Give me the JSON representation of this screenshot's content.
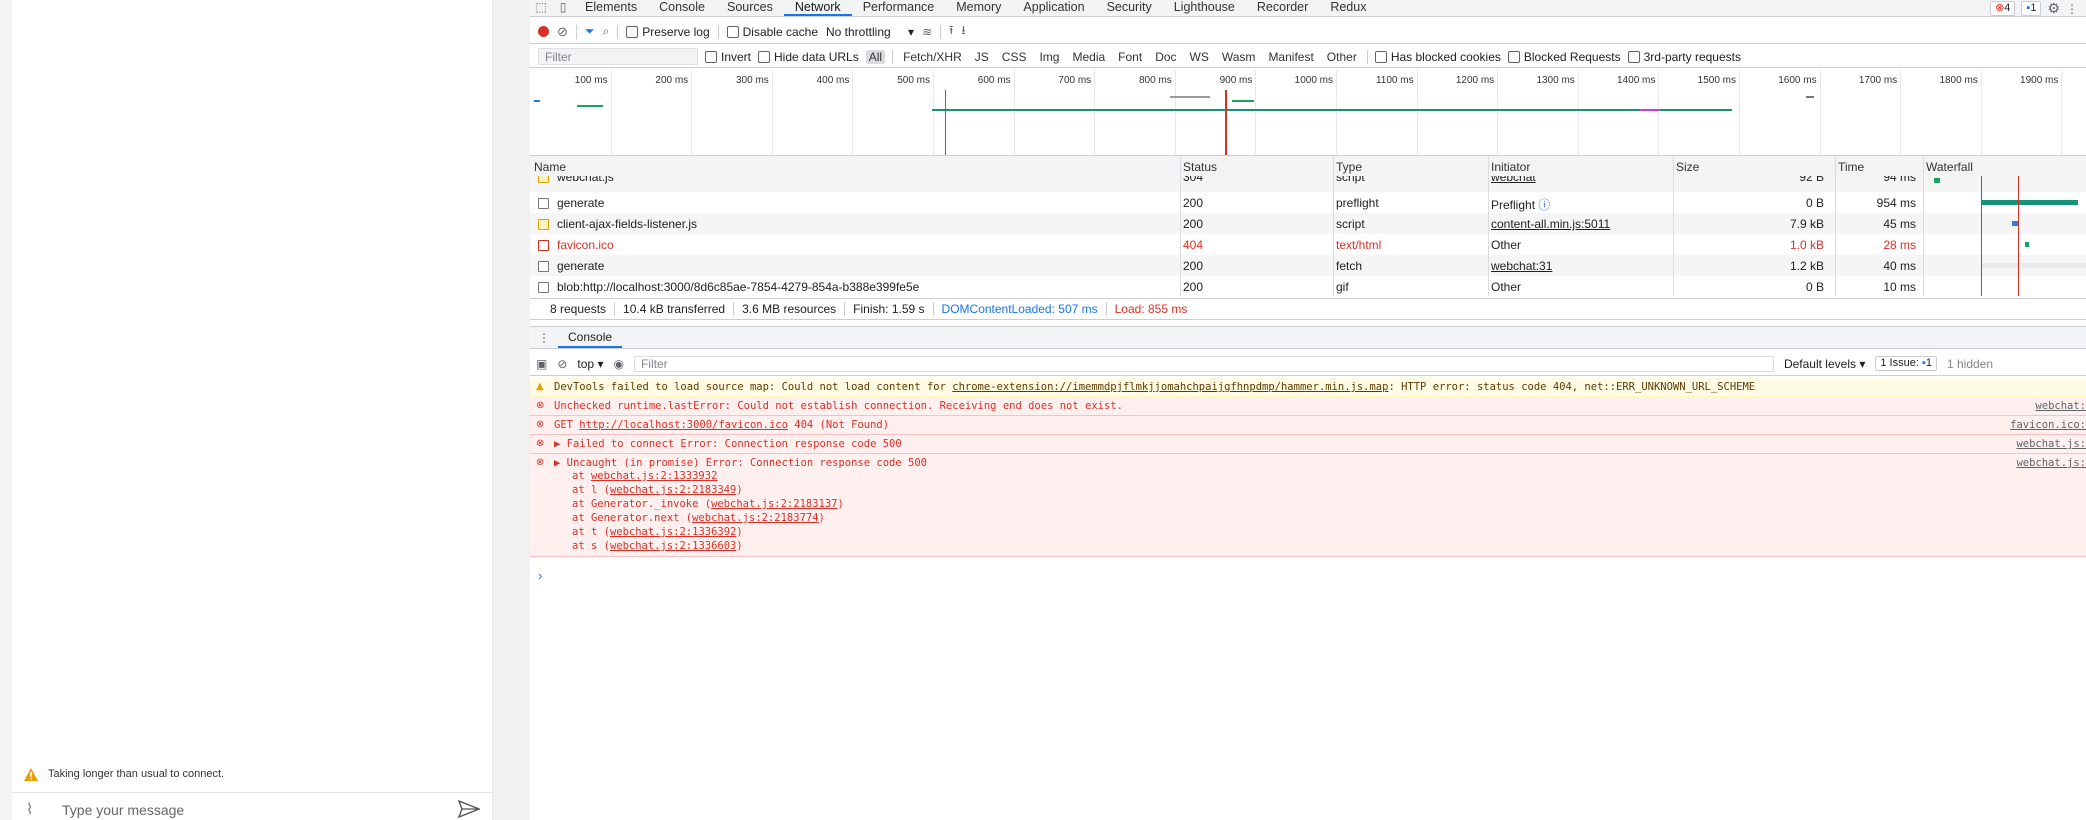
{
  "chat": {
    "warning": "Taking longer than usual to connect.",
    "placeholder": "Type your message"
  },
  "devtools": {
    "tabs": [
      "Elements",
      "Console",
      "Sources",
      "Network",
      "Performance",
      "Memory",
      "Application",
      "Security",
      "Lighthouse",
      "Recorder",
      "Redux"
    ],
    "active_tab": "Network",
    "errors_count": "4",
    "issues_count": "1",
    "toolbar": {
      "preserve_log": "Preserve log",
      "disable_cache": "Disable cache",
      "throttling": "No throttling"
    },
    "filterbar": {
      "placeholder": "Filter",
      "invert": "Invert",
      "hide_data_urls": "Hide data URLs",
      "types": [
        "All",
        "Fetch/XHR",
        "JS",
        "CSS",
        "Img",
        "Media",
        "Font",
        "Doc",
        "WS",
        "Wasm",
        "Manifest",
        "Other"
      ],
      "blocked_cookies": "Has blocked cookies",
      "blocked_requests": "Blocked Requests",
      "third_party": "3rd-party requests"
    },
    "timeline_ticks": [
      "100 ms",
      "200 ms",
      "300 ms",
      "400 ms",
      "500 ms",
      "600 ms",
      "700 ms",
      "800 ms",
      "900 ms",
      "1000 ms",
      "1100 ms",
      "1200 ms",
      "1300 ms",
      "1400 ms",
      "1500 ms",
      "1600 ms",
      "1700 ms",
      "1800 ms",
      "1900 ms"
    ],
    "columns": [
      "Name",
      "Status",
      "Type",
      "Initiator",
      "Size",
      "Time",
      "Waterfall"
    ],
    "rows": [
      {
        "name": "webchat.js",
        "status": "304",
        "type": "script",
        "initiator": "webchat",
        "size": "92 B",
        "time": "94 ms"
      },
      {
        "name": "generate",
        "status": "200",
        "type": "preflight",
        "initiator": "Preflight",
        "size": "0 B",
        "time": "954 ms"
      },
      {
        "name": "client-ajax-fields-listener.js",
        "status": "200",
        "type": "script",
        "initiator": "content-all.min.js:5011",
        "size": "7.9 kB",
        "time": "45 ms"
      },
      {
        "name": "favicon.ico",
        "status": "404",
        "type": "text/html",
        "initiator": "Other",
        "size": "1.0 kB",
        "time": "28 ms"
      },
      {
        "name": "generate",
        "status": "200",
        "type": "fetch",
        "initiator": "webchat:31",
        "size": "1.2 kB",
        "time": "40 ms"
      },
      {
        "name": "blob:http://localhost:3000/8d6c85ae-7854-4279-854a-b388e399fe5e",
        "status": "200",
        "type": "gif",
        "initiator": "Other",
        "size": "0 B",
        "time": "10 ms"
      }
    ],
    "summary": {
      "requests": "8 requests",
      "transferred": "10.4 kB transferred",
      "resources": "3.6 MB resources",
      "finish": "Finish: 1.59 s",
      "dcl": "DOMContentLoaded: 507 ms",
      "load": "Load: 855 ms"
    },
    "console": {
      "tab": "Console",
      "context": "top",
      "filter_placeholder": "Filter",
      "levels": "Default levels",
      "issues": "1 Issue:",
      "issues_count": "1",
      "hidden": "1 hidden",
      "messages": [
        {
          "level": "warning",
          "text_pre": "DevTools failed to load source map: Could not load content for ",
          "link": "chrome-extension://imemmdpjflmkjjomahchpaijgfhnpdmp/hammer.min.js.map",
          "text_post": ": HTTP error: status code 404, net::ERR_UNKNOWN_URL_SCHEME",
          "source": ""
        },
        {
          "level": "error",
          "text_pre": "Unchecked runtime.lastError: Could not establish connection. Receiving end does not exist.",
          "link": "",
          "text_post": "",
          "source": "webchat:"
        },
        {
          "level": "error",
          "text_pre": "GET ",
          "link": "http://localhost:3000/favicon.ico",
          "text_post": " 404 (Not Found)",
          "source": "favicon.ico:"
        },
        {
          "level": "error",
          "text_pre": "▶ Failed to connect Error: Connection response code 500",
          "link": "",
          "text_post": "",
          "source": "webchat.js:"
        },
        {
          "level": "error",
          "text_pre": "▶ Uncaught (in promise) Error: Connection response code 500",
          "link": "",
          "text_post": "",
          "source": "webchat.js:"
        }
      ],
      "stack": [
        {
          "pre": "at ",
          "fn": "",
          "link": "webchat.js:2:1333932"
        },
        {
          "pre": "at l (",
          "fn": "",
          "link": "webchat.js:2:2183349"
        },
        {
          "pre": "at Generator._invoke (",
          "fn": "",
          "link": "webchat.js:2:2183137"
        },
        {
          "pre": "at Generator.next (",
          "fn": "",
          "link": "webchat.js:2:2183774"
        },
        {
          "pre": "at t (",
          "fn": "",
          "link": "webchat.js:2:1336392"
        },
        {
          "pre": "at s (",
          "fn": "",
          "link": "webchat.js:2:1336603"
        }
      ],
      "prompt": "›"
    }
  }
}
